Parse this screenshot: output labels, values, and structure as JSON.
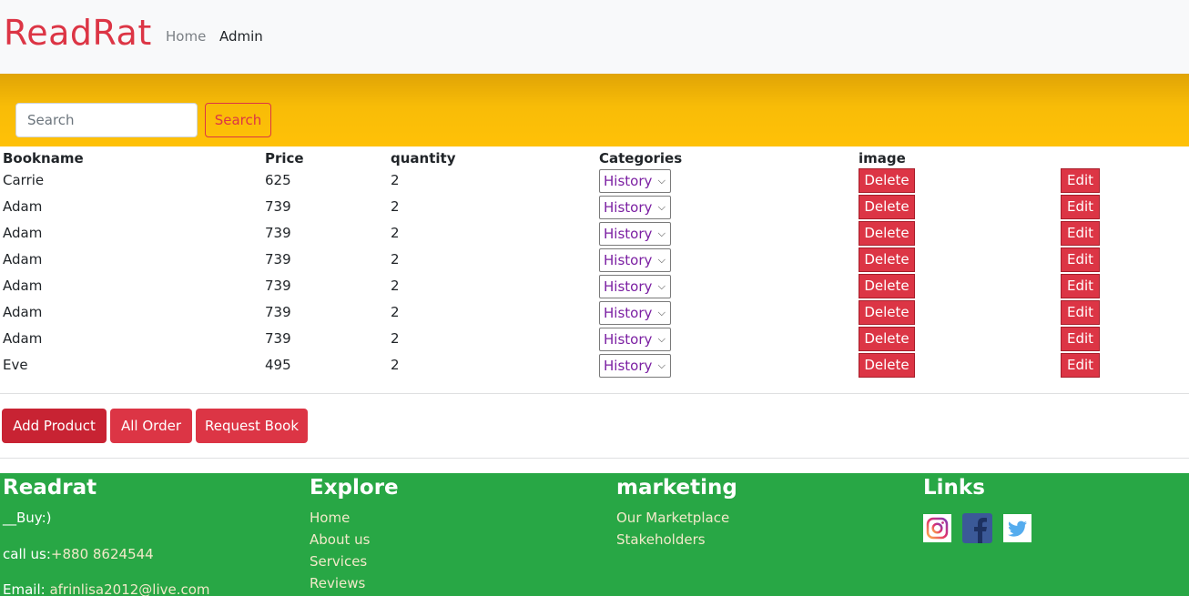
{
  "navbar": {
    "brand": "ReadRat",
    "home": "Home",
    "admin": "Admin"
  },
  "search": {
    "placeholder": "Search",
    "button": "Search"
  },
  "table": {
    "headers": [
      "Bookname",
      "Price",
      "quantity",
      "Categories",
      "image"
    ],
    "rows": [
      {
        "name": "Carrie",
        "price": "625",
        "qty": "2",
        "category": "History"
      },
      {
        "name": "Adam",
        "price": "739",
        "qty": "2",
        "category": "History"
      },
      {
        "name": "Adam",
        "price": "739",
        "qty": "2",
        "category": "History"
      },
      {
        "name": "Adam",
        "price": "739",
        "qty": "2",
        "category": "History"
      },
      {
        "name": "Adam",
        "price": "739",
        "qty": "2",
        "category": "History"
      },
      {
        "name": "Adam",
        "price": "739",
        "qty": "2",
        "category": "History"
      },
      {
        "name": "Adam",
        "price": "739",
        "qty": "2",
        "category": "History"
      },
      {
        "name": "Eve",
        "price": "495",
        "qty": "2",
        "category": "History"
      }
    ],
    "delete_label": "Delete",
    "edit_label": "Edit"
  },
  "actions": {
    "add_product": "Add Product",
    "all_order": "All Order",
    "request_book": "Request Book"
  },
  "footer": {
    "col1": {
      "heading": "Readrat",
      "tagline": "__Buy:)",
      "call_label": "call us:",
      "phone": "+880 8624544",
      "email_label": "Email: ",
      "email": "afrinlisa2012@live.com"
    },
    "col2": {
      "heading": "Explore",
      "links": [
        "Home",
        "About us",
        "Services",
        "Reviews"
      ]
    },
    "col3": {
      "heading": "marketing",
      "links": [
        "Our Marketplace",
        "Stakeholders"
      ]
    },
    "col4": {
      "heading": "Links",
      "icons": [
        "instagram-icon",
        "facebook-icon",
        "twitter-icon"
      ]
    }
  },
  "colors": {
    "brand": "#dc3545",
    "search_band": "#ffc107",
    "footer": "#28a745",
    "category_text": "#7b1fa2"
  }
}
